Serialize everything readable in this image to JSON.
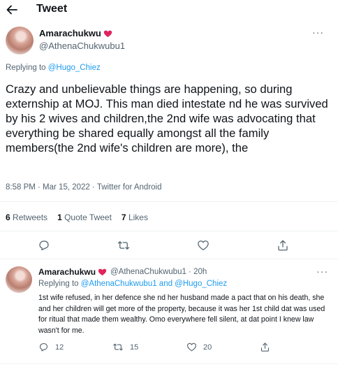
{
  "header": {
    "title": "Tweet"
  },
  "colors": {
    "accent": "#1d9bf0",
    "text": "#0f1419",
    "muted": "#536471",
    "heart_emoji": "#e0245e"
  },
  "main_tweet": {
    "author_name": "Amarachukwu",
    "author_emoji": "heart-emoji",
    "handle": "@AthenaChukwubu1",
    "replying_prefix": "Replying to",
    "replying_to": "@Hugo_Chiez",
    "text": "Crazy and unbelievable things are happening, so during externship at MOJ. This man died intestate nd he was survived by his 2 wives and children,the 2nd wife was advocating that everything be shared equally amongst all the family members(the 2nd wife's children are more), the",
    "timestamp": "8:58 PM · Mar 15, 2022 · Twitter for Android",
    "stats": {
      "retweets_count": "6",
      "retweets_label": "Retweets",
      "quote_count": "1",
      "quote_label": "Quote Tweet",
      "likes_count": "7",
      "likes_label": "Likes"
    },
    "actions": [
      "reply-icon",
      "retweet-icon",
      "like-icon",
      "share-icon"
    ]
  },
  "reply_tweet": {
    "author_name": "Amarachukwu",
    "handle_time": "@AthenaChukwubu1 · 20h",
    "replying_prefix": "Replying to",
    "replying_to": "@AthenaChukwubu1 and @Hugo_Chiez",
    "text": "1st wife refused, in her defence she nd her husband made a pact that on his death, she and her children will get more of the property, because it was her 1st child dat was used for ritual that made them  wealthy. Omo everywhere fell silent, at dat point I knew law wasn't for me.",
    "reply_count": "12",
    "retweet_count": "15",
    "like_count": "20"
  }
}
